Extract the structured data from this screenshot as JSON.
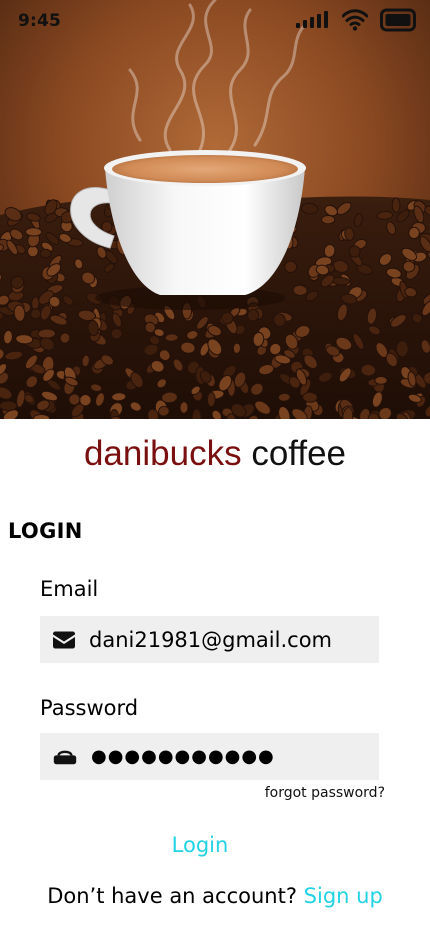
{
  "status_bar": {
    "time": "9:45",
    "icons": [
      "cellular-signal-icon",
      "wifi-icon",
      "battery-icon"
    ]
  },
  "hero": {
    "image": "coffee-cup-on-beans-photo"
  },
  "brand": {
    "name": "danibucks",
    "word": "coffee",
    "name_color": "#7a0f0f"
  },
  "login": {
    "heading": "LOGIN",
    "email_label": "Email",
    "email_value": "dani21981@gmail.com",
    "email_icon": "envelope-icon",
    "password_label": "Password",
    "password_value": "●●●●●●●●●●●",
    "password_icon": "lock-icon",
    "forgot_label": "forgot password?",
    "submit_label": "Login",
    "signup_prompt": "Don’t have an account?",
    "signup_label": "Sign up",
    "accent_color": "#22d3e6"
  }
}
